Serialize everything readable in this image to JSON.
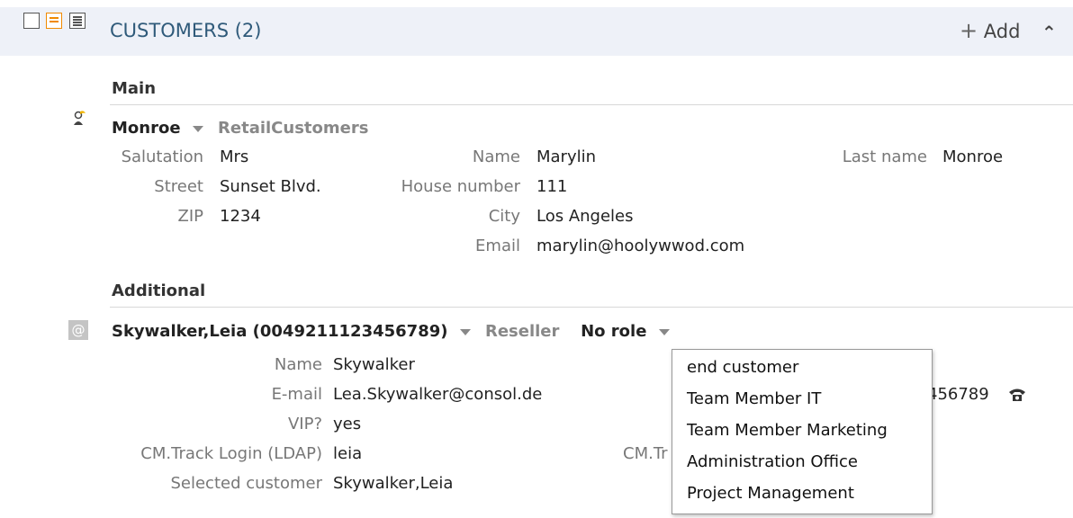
{
  "header": {
    "title": "CUSTOMERS (2)",
    "add_label": "Add",
    "add_glyph": "+",
    "collapse_glyph": "⌃"
  },
  "groups": {
    "main": "Main",
    "additional": "Additional"
  },
  "customer1": {
    "name": "Monroe",
    "group": "RetailCustomers",
    "fields": {
      "salutation": {
        "label": "Salutation",
        "value": "Mrs"
      },
      "name": {
        "label": "Name",
        "value": "Marylin"
      },
      "last_name": {
        "label": "Last name",
        "value": "Monroe"
      },
      "street": {
        "label": "Street",
        "value": "Sunset Blvd."
      },
      "house_number": {
        "label": "House number",
        "value": "111"
      },
      "zip": {
        "label": "ZIP",
        "value": "1234"
      },
      "city": {
        "label": "City",
        "value": "Los Angeles"
      },
      "email": {
        "label": "Email",
        "value": "marylin@hoolywwod.com"
      }
    }
  },
  "customer2": {
    "name": "Skywalker,Leia (0049211123456789)",
    "group": "Reseller",
    "role": "No role",
    "fields": {
      "name": {
        "label": "Name",
        "value": "Skywalker"
      },
      "email": {
        "label": "E-mail",
        "value": "Lea.Skywalker@consol.de"
      },
      "phone": {
        "value": "456789"
      },
      "vip": {
        "label": "VIP?",
        "value": "yes"
      },
      "ldap": {
        "label": "CM.Track Login (LDAP)",
        "value": "leia"
      },
      "cm_tr": {
        "label": "CM.Tr"
      },
      "selected": {
        "label": "Selected customer",
        "value": "Skywalker,Leia"
      }
    }
  },
  "role_menu": {
    "options": [
      "end customer",
      "Team Member IT",
      "Team Member Marketing",
      "Administration Office",
      "Project Management"
    ]
  },
  "icons": {
    "contact_icon": "person-icon",
    "email_icon": "at-icon",
    "phone_icon": "phone-icon",
    "accent_color": "#f08a00"
  }
}
